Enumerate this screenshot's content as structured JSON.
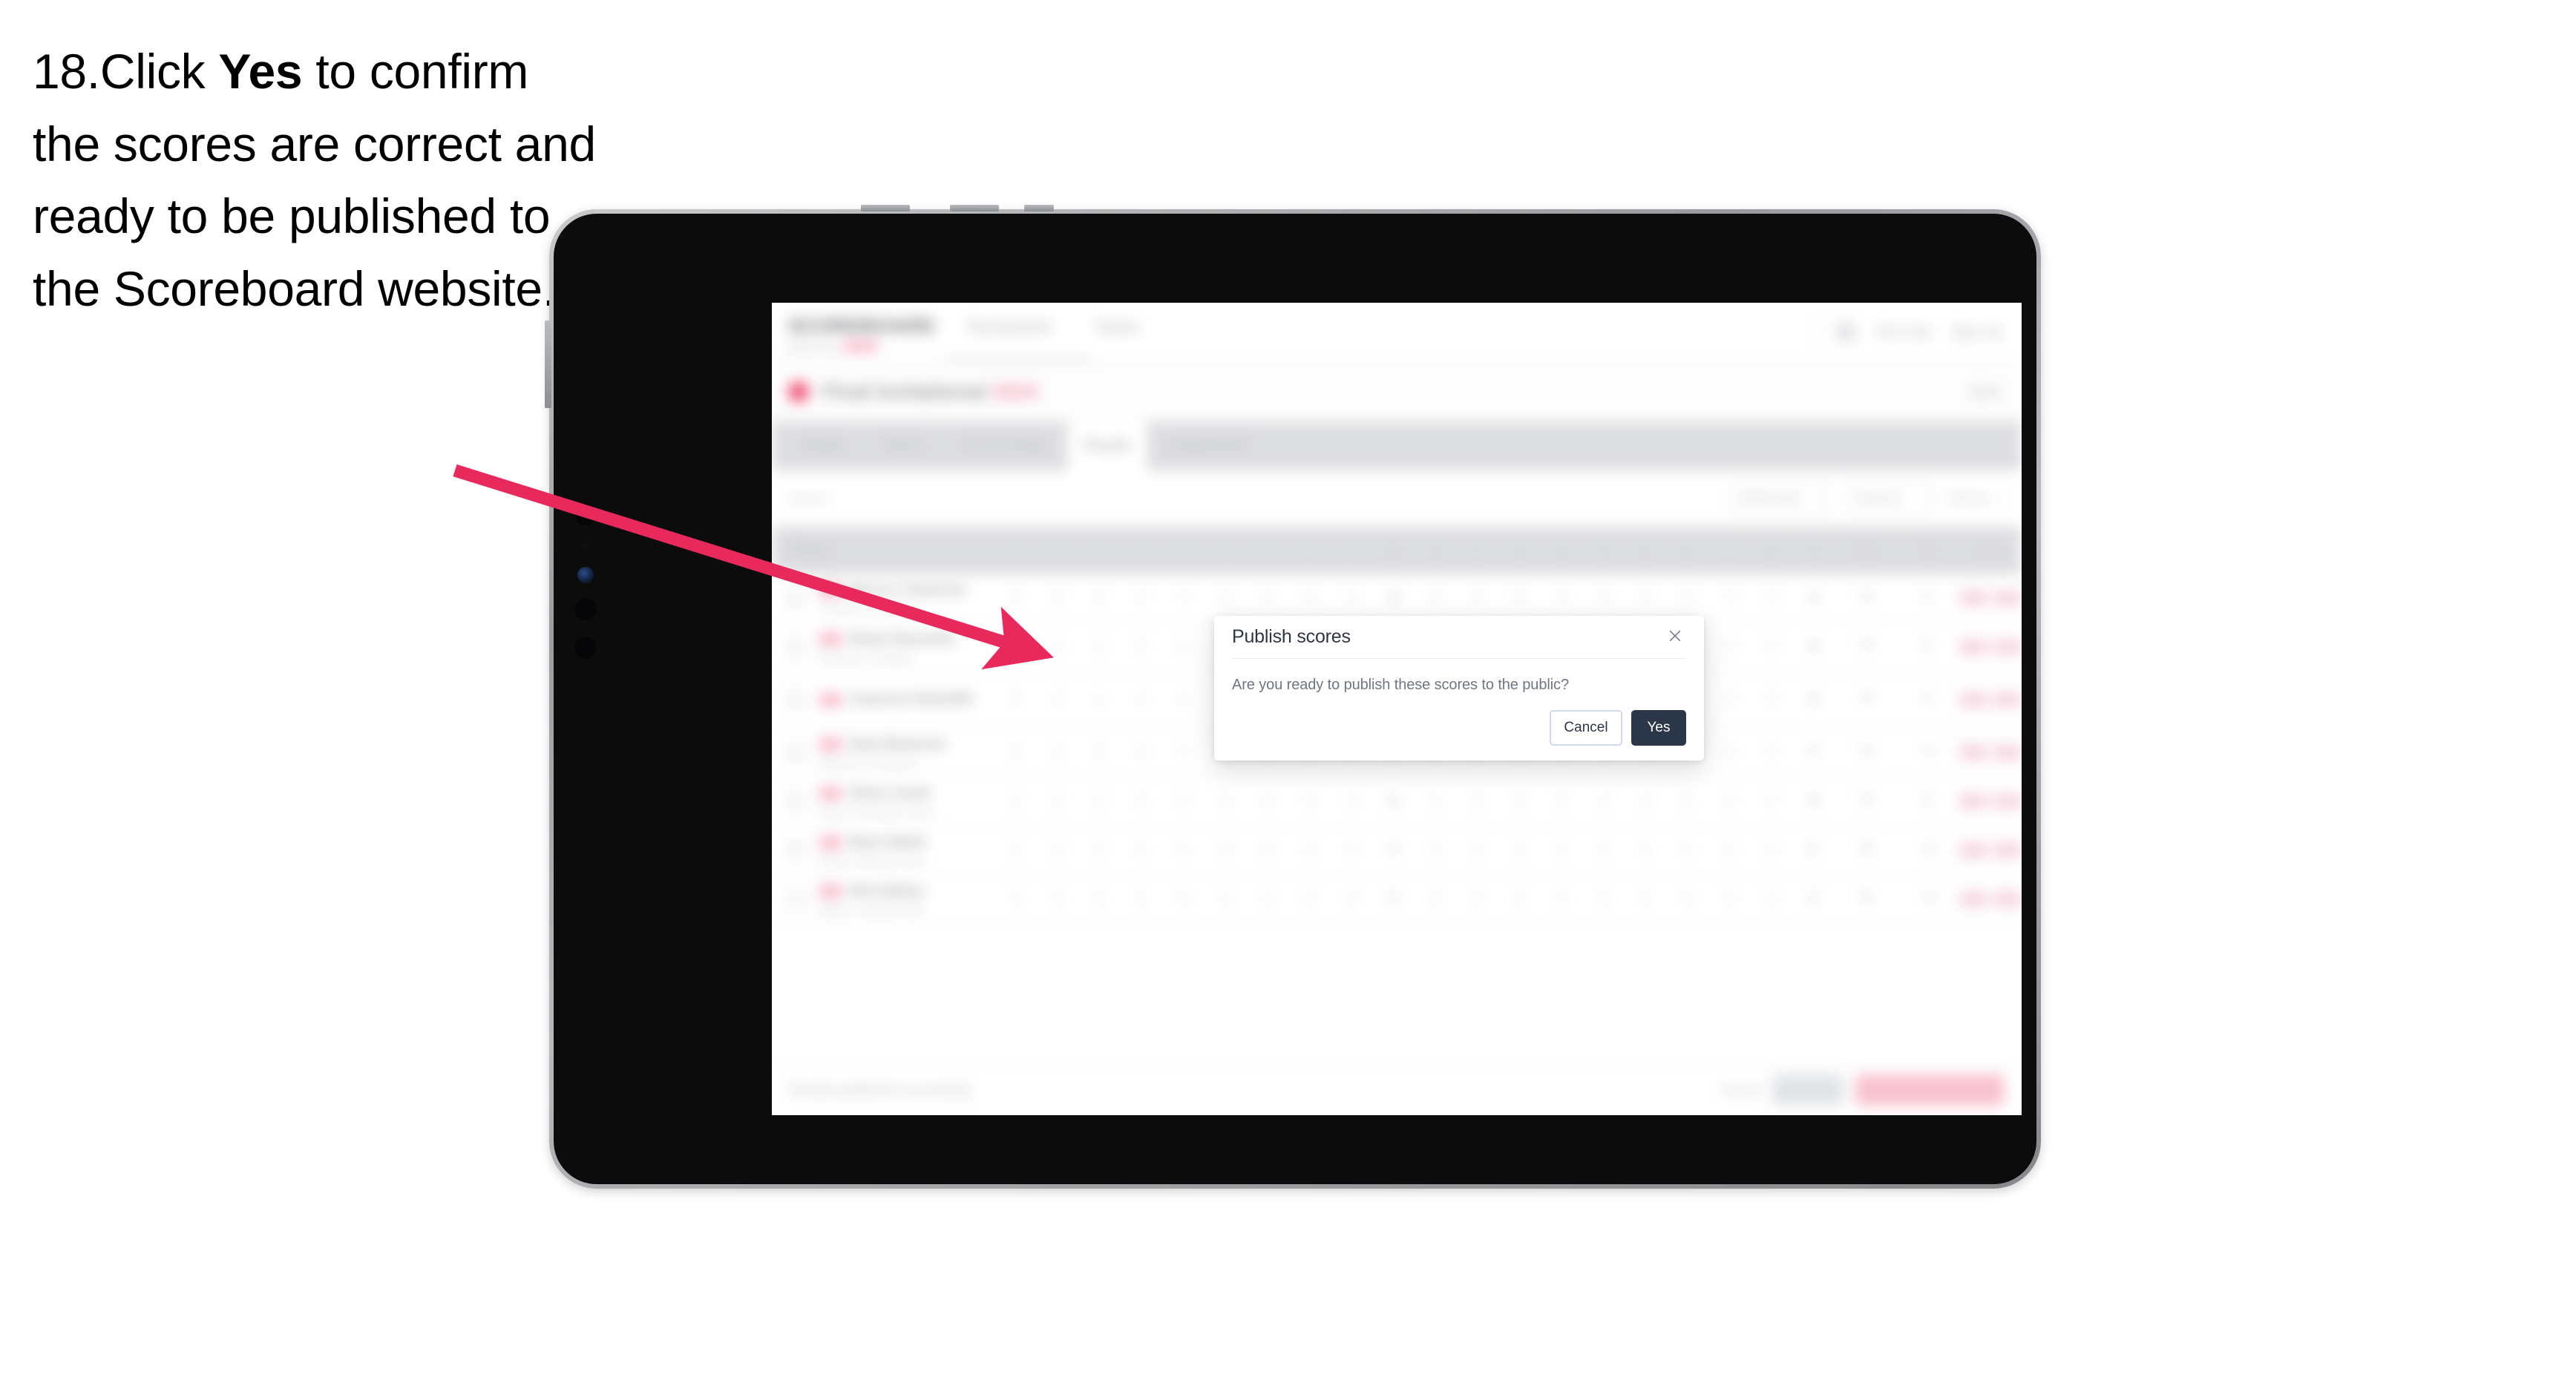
{
  "instruction": {
    "step_number": "18.",
    "before_bold": "Click ",
    "bold": "Yes",
    "after_bold": " to confirm the scores are correct and ready to be published to the Scoreboard website."
  },
  "annotation": {
    "arrow_color": "#e8295c",
    "arrow_name": "pointer-arrow",
    "points_to": "yes-button"
  },
  "device": {
    "type": "tablet",
    "frame_color": "#9a9c9f",
    "bezel_color": "#0c0c0d"
  },
  "app": {
    "header": {
      "brand": "SCOREBOARD",
      "brand_sub": "powered by",
      "nav": [
        "Tournaments",
        "Teams"
      ],
      "user_name": "Tour User",
      "sign_out": "Sign out"
    },
    "sub_header": {
      "title": "Final Invitational",
      "title_accent": "2024",
      "right": "Back"
    },
    "tabs": [
      {
        "label": "Details",
        "active": false
      },
      {
        "label": "Teams",
        "active": false
      },
      {
        "label": "Course Setup",
        "active": false
      },
      {
        "label": "Results",
        "active": true
      },
      {
        "label": "Leaderboard",
        "active": false
      }
    ],
    "filterbar": {
      "search_placeholder": "Search",
      "filters": [
        "All Rounds",
        "Round 1",
        "Sort by"
      ]
    },
    "table": {
      "columns": {
        "player": "Player",
        "holes": [
          "1",
          "2",
          "3",
          "4",
          "5",
          "6",
          "7",
          "8",
          "9",
          "OUT",
          "10",
          "11",
          "12",
          "13",
          "14",
          "15",
          "16",
          "17",
          "18",
          "IN"
        ],
        "tail": [
          "Total",
          "Par",
          "Score"
        ]
      },
      "rows": [
        {
          "name": "Marcus Thomson",
          "sub": "Thomson / Lockwood",
          "scores": [
            "4",
            "3",
            "5",
            "4",
            "3",
            "4",
            "5",
            "4",
            "4",
            "36",
            "4",
            "3",
            "5",
            "4",
            "4",
            "3",
            "5",
            "4",
            "4",
            "36"
          ],
          "total": "72",
          "par": "E",
          "pills": 2
        },
        {
          "name": "Ethan Reynolds",
          "sub": "Reynolds / Hastings",
          "scores": [
            "4",
            "4",
            "4",
            "5",
            "3",
            "4",
            "4",
            "4",
            "4",
            "36",
            "4",
            "4",
            "4",
            "5",
            "3",
            "4",
            "4",
            "4",
            "4",
            "36"
          ],
          "total": "72",
          "par": "E",
          "pills": 2
        },
        {
          "name": "Cameron Radcliffe",
          "sub": "",
          "scores": [
            "5",
            "3",
            "4",
            "4",
            "4",
            "4",
            "5",
            "4",
            "3",
            "36",
            "5",
            "3",
            "4",
            "4",
            "4",
            "4",
            "5",
            "4",
            "3",
            "36"
          ],
          "total": "72",
          "par": "E",
          "pills": 2
        },
        {
          "name": "Dale Mckenzie",
          "sub": "Mckenzie / Fairbanks",
          "scores": [
            "4",
            "4",
            "5",
            "4",
            "3",
            "4",
            "4",
            "5",
            "4",
            "37",
            "4",
            "4",
            "5",
            "4",
            "3",
            "4",
            "4",
            "5",
            "4",
            "37"
          ],
          "total": "74",
          "par": "+2",
          "pills": 2
        },
        {
          "name": "Oliver Grant",
          "sub": "Grant / Pemberton-Shaw",
          "scores": [
            "4",
            "3",
            "4",
            "5",
            "4",
            "3",
            "5",
            "4",
            "4",
            "36",
            "4",
            "3",
            "4",
            "5",
            "4",
            "3",
            "5",
            "4",
            "4",
            "36"
          ],
          "total": "72",
          "par": "E",
          "pills": 2
        },
        {
          "name": "Ryan Webb",
          "sub": "Webb / Ashworth-Lane",
          "scores": [
            "5",
            "4",
            "4",
            "4",
            "3",
            "4",
            "4",
            "4",
            "5",
            "37",
            "5",
            "4",
            "4",
            "4",
            "3",
            "4",
            "4",
            "4",
            "5",
            "37"
          ],
          "total": "74",
          "par": "+2",
          "pills": 2
        },
        {
          "name": "Nick Bailey",
          "sub": "Bailey / Crawford-Hale",
          "scores": [
            "4",
            "4",
            "5",
            "4",
            "4",
            "3",
            "4",
            "5",
            "4",
            "37",
            "4",
            "4",
            "5",
            "4",
            "4",
            "3",
            "4",
            "5",
            "4",
            "37"
          ],
          "total": "74",
          "par": "+2",
          "pills": 2
        }
      ]
    },
    "bottombar": {
      "note": "Results published successfully",
      "cancel": "Cancel",
      "save": "Save",
      "publish": "Publish and notify team"
    }
  },
  "modal": {
    "title": "Publish scores",
    "message": "Are you ready to publish these scores to the public?",
    "cancel_label": "Cancel",
    "confirm_label": "Yes",
    "close_icon": "close-icon",
    "confirm_color": "#2b3748",
    "cancel_border_color": "#cfd9ef"
  }
}
